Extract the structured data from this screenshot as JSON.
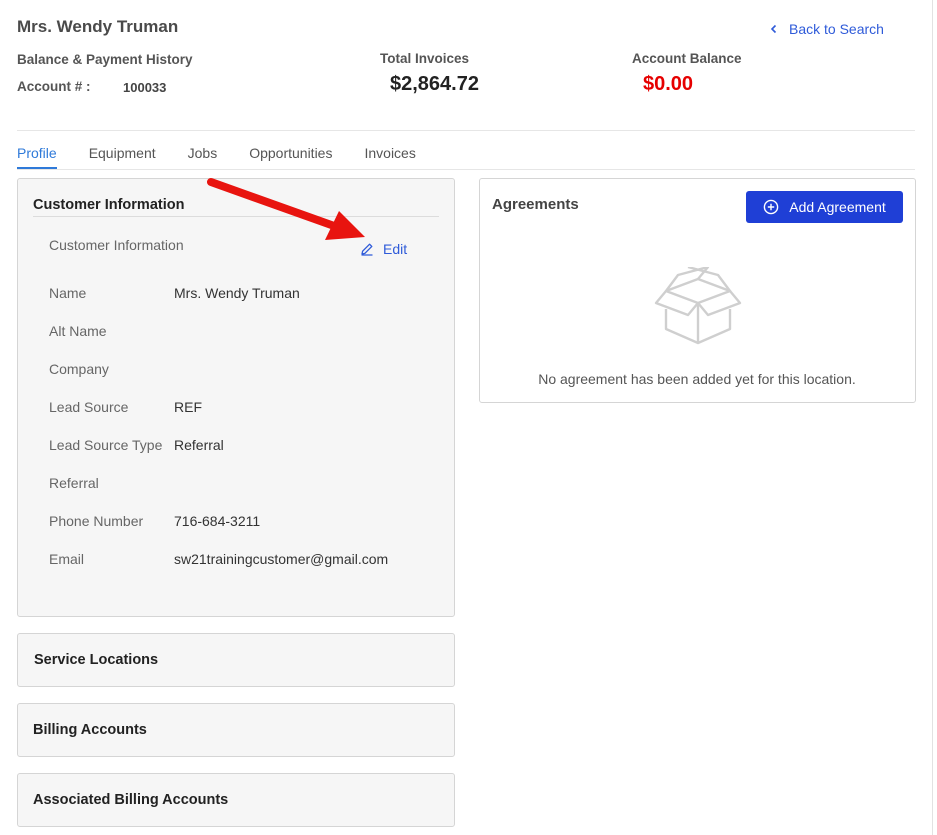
{
  "header": {
    "customer_name": "Mrs. Wendy Truman",
    "back_link": "Back to Search",
    "subtitle": "Balance & Payment History",
    "account_label": "Account # :",
    "account_number": "100033",
    "total_invoices_label": "Total Invoices",
    "total_invoices_value": "$2,864.72",
    "account_balance_label": "Account Balance",
    "account_balance_value": "$0.00"
  },
  "tabs": [
    {
      "label": "Profile",
      "active": true
    },
    {
      "label": "Equipment"
    },
    {
      "label": "Jobs"
    },
    {
      "label": "Opportunities"
    },
    {
      "label": "Invoices"
    }
  ],
  "customer_info": {
    "title": "Customer Information",
    "subtitle": "Customer Information",
    "edit_label": "Edit",
    "fields": [
      {
        "label": "Name",
        "value": "Mrs. Wendy Truman"
      },
      {
        "label": "Alt Name",
        "value": ""
      },
      {
        "label": "Company",
        "value": ""
      },
      {
        "label": "Lead Source",
        "value": "REF"
      },
      {
        "label": "Lead Source Type",
        "value": "Referral"
      },
      {
        "label": "Referral",
        "value": ""
      },
      {
        "label": "Phone Number",
        "value": "716-684-3211"
      },
      {
        "label": "Email",
        "value": "sw21trainingcustomer@gmail.com"
      }
    ]
  },
  "sections": {
    "service_locations": "Service Locations",
    "billing_accounts": "Billing Accounts",
    "associated_billing_accounts": "Associated Billing Accounts"
  },
  "agreements": {
    "title": "Agreements",
    "add_button": "Add Agreement",
    "empty_text": "No agreement has been added yet for this location."
  },
  "colors": {
    "accent_blue": "#2f5bd9",
    "button_blue": "#1f3fd6",
    "balance_red": "#e60000",
    "annotation_arrow": "#e8140f"
  }
}
